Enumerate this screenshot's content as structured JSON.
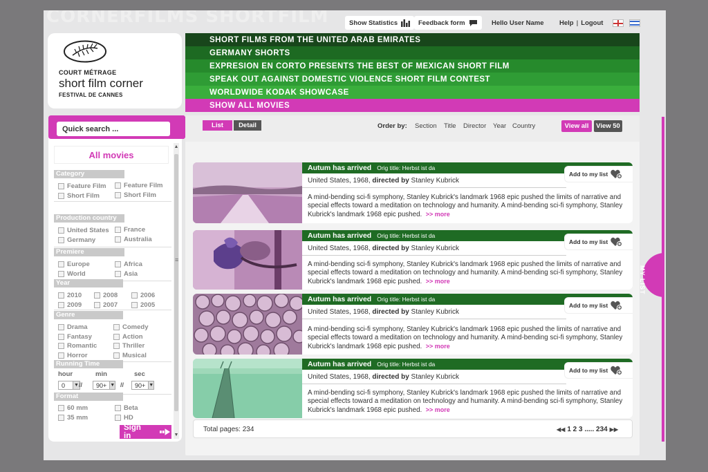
{
  "watermark": "CORNERFILMS SHORTFILM",
  "topbar": {
    "show_statistics": "Show Statistics",
    "feedback_form": "Feedback form",
    "hello": "Hello User Name",
    "help": "Help",
    "logout": "Logout"
  },
  "logo": {
    "line1": "COURT MÉTRAGE",
    "line2": "short film corner",
    "line3": "FESTIVAL DE CANNES"
  },
  "menu": [
    {
      "label": "SHORT FILMS FROM THE UNITED ARAB EMIRATES",
      "color": "#18461b"
    },
    {
      "label": "GERMANY SHORTS",
      "color": "#1d6a22"
    },
    {
      "label": "EXPRESION EN CORTO PRESENTS THE BEST OF MEXICAN SHORT FILM",
      "color": "#268a2c"
    },
    {
      "label": "SPEAK  OUT AGAINST DOMESTIC VIOLENCE SHORT FILM CONTEST",
      "color": "#2f9c35"
    },
    {
      "label": "WORLDWIDE KODAK SHOWCASE",
      "color": "#3aae3c"
    },
    {
      "label": "SHOW ALL MOVIES",
      "color": "#d23ab6"
    }
  ],
  "sidebar": {
    "quick_search_value": "Quick search ...",
    "all_movies": "All movies",
    "category": {
      "title": "Category",
      "options": [
        "Feature Film",
        "Feature Film",
        "Short Film",
        "Short Film"
      ]
    },
    "country": {
      "title": "Production country",
      "options": [
        "United States",
        "France",
        "Germany",
        "Australia"
      ]
    },
    "premiere": {
      "title": "Premiere",
      "options": [
        "Europe",
        "Africa",
        "World",
        "Asia"
      ]
    },
    "year": {
      "title": "Year",
      "options": [
        "2010",
        "2008",
        "2006",
        "2009",
        "2007",
        "2005"
      ]
    },
    "genre": {
      "title": "Genre",
      "options": [
        "Drama",
        "Comedy",
        "Fantasy",
        "Action",
        "Romantic",
        "Thriller",
        "Horror",
        "Musical"
      ]
    },
    "running_time": {
      "title": "Running Time",
      "hour_label": "hour",
      "min_label": "min",
      "sec_label": "sec",
      "hour_value": "0",
      "min_value": "90+",
      "sec_value": "90+",
      "sep1": "//",
      "sep2": "//"
    },
    "format": {
      "title": "Format",
      "options": [
        "60 mm",
        "Beta",
        "35 mm",
        "HD"
      ]
    },
    "sign_in": "Sign in"
  },
  "main": {
    "list_label": "List",
    "detail_label": "Detail",
    "order_by": "Order by:",
    "order_options": [
      "Section",
      "Title",
      "Director",
      "Year",
      "Country"
    ],
    "view_all": "View all",
    "view_50": "View 50",
    "add_to_list": "Add to my list",
    "more": ">> more",
    "movies": [
      {
        "title": "Autum has arrived",
        "orig": "Orig title: Herbst ist da",
        "country_year": "United States, 1968,",
        "directed_by": "directed by",
        "director": "Stanley Kubrick",
        "desc": "A mind-bending sci-fi symphony, Stanley Kubrick's landmark 1968 epic pushed the limits of narrative and special effects toward a meditation on technology and humanity. A mind-bending sci-fi symphony, Stanley Kubrick's landmark 1968 epic pushed."
      },
      {
        "title": "Autum has arrived",
        "orig": "Orig title: Herbst ist da",
        "country_year": "United States, 1968,",
        "directed_by": "directed by",
        "director": "Stanley Kubrick",
        "desc": "A mind-bending sci-fi symphony, Stanley Kubrick's landmark 1968 epic pushed the limits of narrative and special effects toward a meditation on technology and humanity. A mind-bending sci-fi symphony, Stanley Kubrick's landmark 1968 epic pushed."
      },
      {
        "title": "Autum has arrived",
        "orig": "Orig title: Herbst ist da",
        "country_year": "United States, 1968,",
        "directed_by": "directed by",
        "director": "Stanley Kubrick",
        "desc": "A mind-bending sci-fi symphony, Stanley Kubrick's landmark 1968 epic pushed the limits of narrative and special effects toward a meditation on technology and humanity. A mind-bending sci-fi symphony, Stanley Kubrick's landmark 1968 epic pushed."
      },
      {
        "title": "Autum has arrived",
        "orig": "Orig title: Herbst ist da",
        "country_year": "United States, 1968,",
        "directed_by": "directed by",
        "director": "Stanley Kubrick",
        "desc": "A mind-bending sci-fi symphony, Stanley Kubrick's landmark 1968 epic pushed the limits of narrative and special effects toward a meditation on technology and humanity. A mind-bending sci-fi symphony, Stanley Kubrick's landmark 1968 epic pushed."
      }
    ],
    "total_pages": "Total pages: 234",
    "pages": "1 2 3 ..... 234"
  },
  "my_list": "MY LIST",
  "colors": {
    "accent_pink": "#d23ab6",
    "dark_green": "#1f6b24",
    "gray_button": "#555555"
  },
  "icons": [
    "bar-chart-icon",
    "speech-bubble-icon",
    "uk-flag-icon",
    "israel-flag-icon",
    "palm-logo-icon",
    "heart-plus-icon",
    "arrow-right-icon",
    "first-page-icon",
    "last-page-icon"
  ]
}
